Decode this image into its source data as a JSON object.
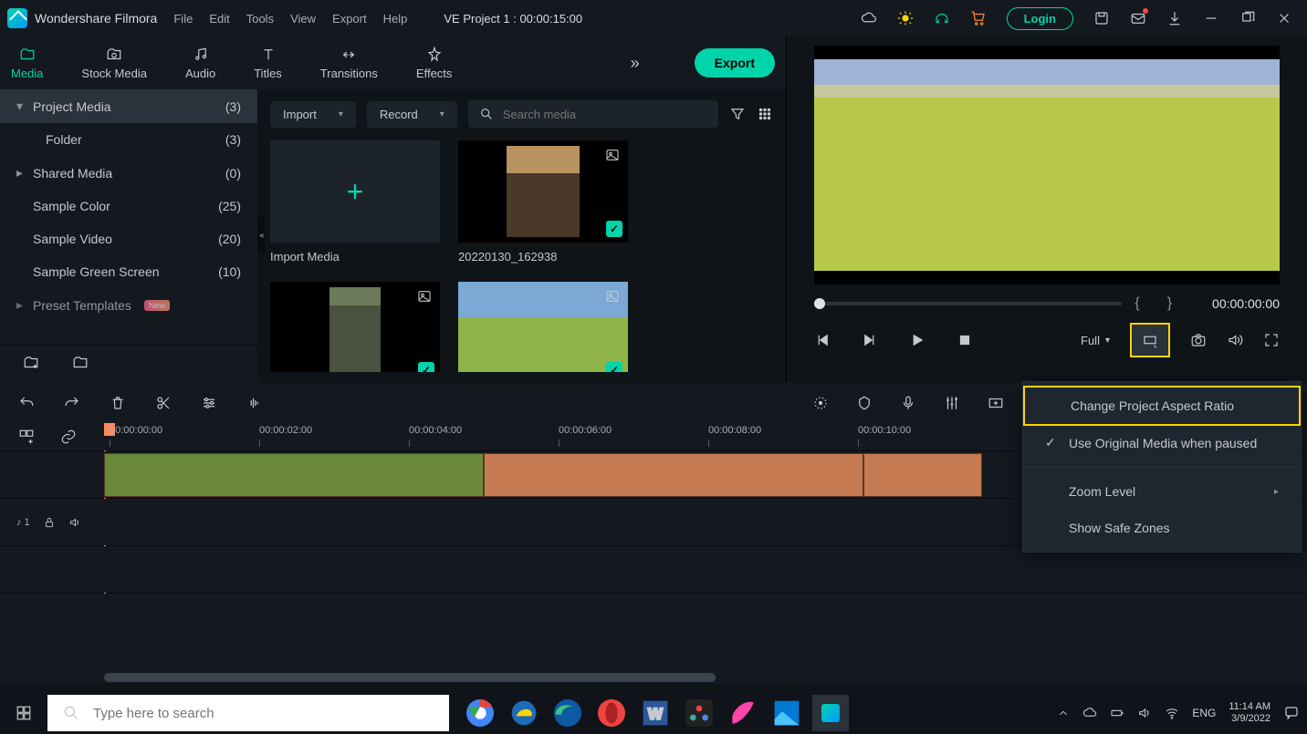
{
  "app_name": "Wondershare Filmora",
  "menubar": [
    "File",
    "Edit",
    "Tools",
    "View",
    "Export",
    "Help"
  ],
  "project_title": "VE Project 1 : 00:00:15:00",
  "login_label": "Login",
  "tabs": [
    {
      "label": "Media",
      "active": true
    },
    {
      "label": "Stock Media"
    },
    {
      "label": "Audio"
    },
    {
      "label": "Titles"
    },
    {
      "label": "Transitions"
    },
    {
      "label": "Effects"
    }
  ],
  "export_label": "Export",
  "sidebar": [
    {
      "label": "Project Media",
      "count": "(3)",
      "caret": "▾",
      "sel": true
    },
    {
      "label": "Folder",
      "count": "(3)",
      "sub": true
    },
    {
      "label": "Shared Media",
      "count": "(0)",
      "caret": "▸"
    },
    {
      "label": "Sample Color",
      "count": "(25)"
    },
    {
      "label": "Sample Video",
      "count": "(20)"
    },
    {
      "label": "Sample Green Screen",
      "count": "(10)"
    },
    {
      "label": "Preset Templates",
      "caret": "▸",
      "badge": "New"
    }
  ],
  "import_dd": "Import",
  "record_dd": "Record",
  "search_placeholder": "Search media",
  "thumbs": [
    {
      "label": "Import Media",
      "type": "import"
    },
    {
      "label": "20220130_162938",
      "type": "v1",
      "check": true
    },
    {
      "label": "",
      "type": "v3",
      "check": true
    },
    {
      "label": "",
      "type": "v2",
      "check": true
    }
  ],
  "timecode": "00:00:00:00",
  "full_label": "Full",
  "context_menu": [
    {
      "label": "Change Project Aspect Ratio",
      "hl": true
    },
    {
      "label": "Use Original Media when paused",
      "checked": true
    },
    {
      "sep": true
    },
    {
      "label": "Zoom Level",
      "arrow": true
    },
    {
      "label": "Show Safe Zones"
    }
  ],
  "ruler_marks": [
    "00:00:00:00",
    "00:00:02:00",
    "00:00:04:00",
    "00:00:06:00",
    "00:00:08:00",
    "00:00:10:00"
  ],
  "audio_track_label": "♪ 1",
  "taskbar": {
    "search_placeholder": "Type here to search",
    "lang": "ENG",
    "time": "11:14 AM",
    "date": "3/9/2022"
  }
}
